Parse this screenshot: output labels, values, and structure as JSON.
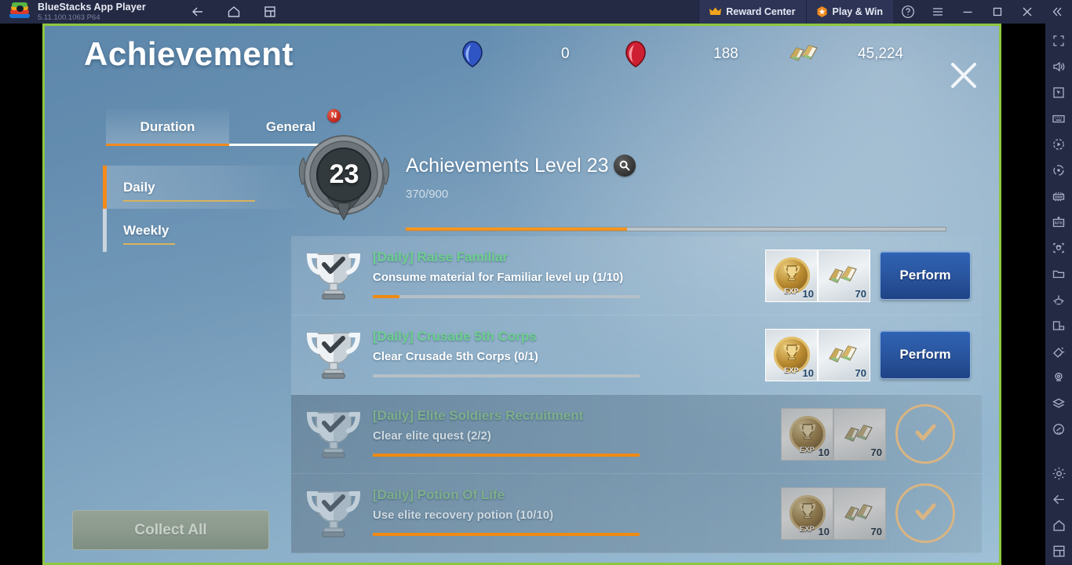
{
  "bluestacks": {
    "title": "BlueStacks App Player",
    "version": "5.11.100.1063  P64",
    "nav": [
      {
        "name": "back-icon",
        "label": "Back"
      },
      {
        "name": "home-icon",
        "label": "Home"
      },
      {
        "name": "multi-instance-icon",
        "label": "Multi-instance"
      }
    ],
    "reward_center": "Reward Center",
    "play_and_win": "Play & Win",
    "window_buttons": [
      "help-icon",
      "menu-icon",
      "minimize-icon",
      "maximize-icon",
      "close-icon",
      "collapse-icon"
    ],
    "sidebar_icons": [
      "fullscreen-icon",
      "volume-icon",
      "cursor-icon",
      "keyboard-icon",
      "macro-record-icon",
      "rotate-icon",
      "gamepad-icon",
      "apk-install-icon",
      "screenshot-icon",
      "media-folder-icon",
      "eco-mode-icon",
      "multi-window-icon",
      "trim-icon",
      "location-icon",
      "layers-icon",
      "performance-icon"
    ],
    "sidebar_bottom_icons": [
      "gear-icon",
      "back-icon",
      "home-icon",
      "recents-icon"
    ]
  },
  "game": {
    "title": "Achievement",
    "close_label": "×",
    "currencies": [
      {
        "icon": "blue-gem-icon",
        "value": "0"
      },
      {
        "icon": "red-gem-icon",
        "value": "188"
      },
      {
        "icon": "scroll-icon",
        "value": "45,224"
      }
    ],
    "tabs": [
      {
        "label": "Duration",
        "active": true,
        "badge": ""
      },
      {
        "label": "General",
        "active": false,
        "badge": "N"
      }
    ],
    "left_nav": [
      {
        "label": "Daily",
        "active": true
      },
      {
        "label": "Weekly",
        "active": false
      }
    ],
    "collect_all_label": "Collect All",
    "level": {
      "medal_number": "23",
      "title": "Achievements Level 23",
      "search_icon": "search-icon",
      "progress_text": "370/900",
      "progress_percent": 41
    },
    "rows": [
      {
        "title": "[Daily] Raise Familiar",
        "desc": "Consume material for Familiar level up (1/10)",
        "progress_percent": 10,
        "state": "open",
        "rewards": [
          {
            "icon": "exp-coin-icon",
            "label": "EXP",
            "qty": "10"
          },
          {
            "icon": "scroll-icon",
            "label": "",
            "qty": "70"
          }
        ],
        "action_label": "Perform"
      },
      {
        "title": "[Daily] Crusade 5th Corps",
        "desc": "Clear Crusade 5th Corps (0/1)",
        "progress_percent": 0,
        "state": "open",
        "rewards": [
          {
            "icon": "exp-coin-icon",
            "label": "EXP",
            "qty": "10"
          },
          {
            "icon": "scroll-icon",
            "label": "",
            "qty": "70"
          }
        ],
        "action_label": "Perform"
      },
      {
        "title": "[Daily] Elite Soldiers Recruitment",
        "desc": "Clear elite quest (2/2)",
        "progress_percent": 100,
        "state": "done",
        "rewards": [
          {
            "icon": "exp-coin-icon",
            "label": "EXP",
            "qty": "10"
          },
          {
            "icon": "scroll-icon",
            "label": "",
            "qty": "70"
          }
        ],
        "action_label": "claim-check"
      },
      {
        "title": "[Daily] Potion Of Life",
        "desc": "Use elite recovery potion (10/10)",
        "progress_percent": 100,
        "state": "done",
        "rewards": [
          {
            "icon": "exp-coin-icon",
            "label": "EXP",
            "qty": "10"
          },
          {
            "icon": "scroll-icon",
            "label": "",
            "qty": "70"
          }
        ],
        "action_label": "claim-check"
      }
    ]
  },
  "colors": {
    "accent_orange": "#f08a1d",
    "tab_active_underline": "#f08a1d",
    "title_green": "#6ecf8e",
    "button_blue": "#2a56a0",
    "frame_green": "#8ec63f",
    "chrome_navy": "#242a44"
  }
}
